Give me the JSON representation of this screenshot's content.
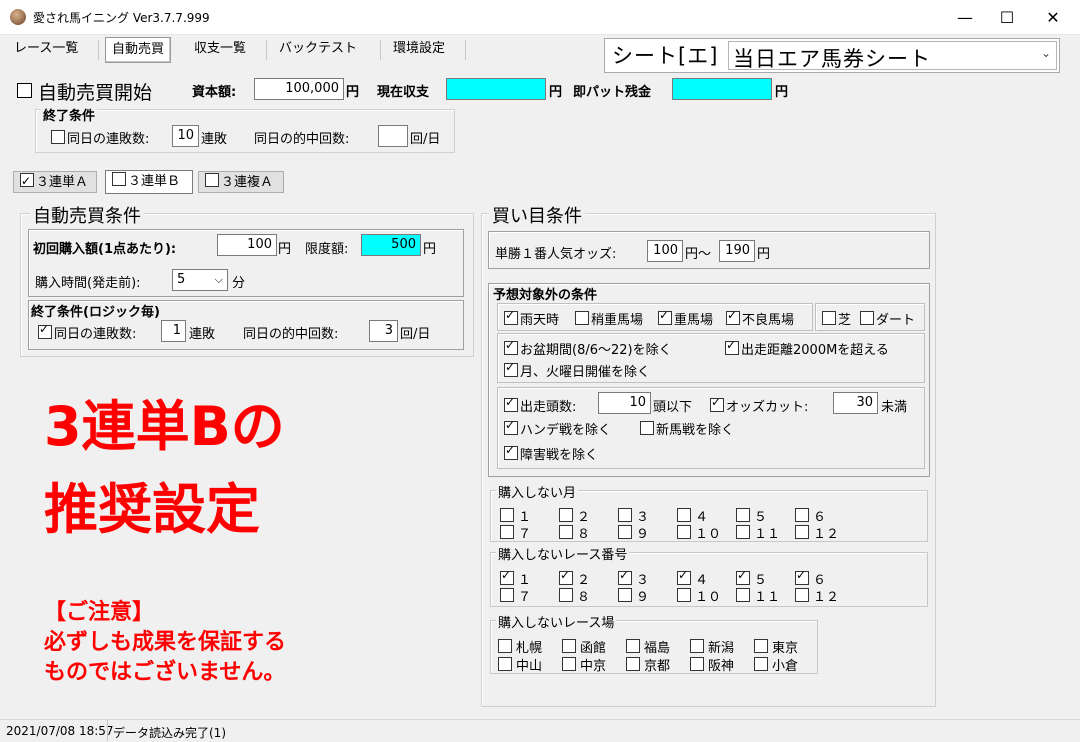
{
  "window": {
    "title": "愛され馬イニング Ver3.7.7.999",
    "minimize": "—",
    "maximize": "☐",
    "close": "✕"
  },
  "tabs": [
    "レース一覧",
    "自動売買",
    "収支一覧",
    "バックテスト",
    "環境設定"
  ],
  "sheet": {
    "label": "シート[エ]",
    "value": "当日エア馬券シート"
  },
  "auto": {
    "start_label": "自動売買開始",
    "capital_label": "資本額:",
    "capital_value": "100,000",
    "yen": "円",
    "profit_label": "現在収支",
    "bat_label": "即パット残金",
    "end_title": "終了条件",
    "end_streak_label": "同日の連敗数:",
    "end_streak_value": "10",
    "end_streak_unit": "連敗",
    "end_hits_label": "同日の的中回数:",
    "end_hits_value": "",
    "end_hits_unit": "回/日"
  },
  "bet_tabs": [
    {
      "label": "３連単Ａ",
      "checked": true
    },
    {
      "label": "３連単Ｂ",
      "checked": false
    },
    {
      "label": "３連複Ａ",
      "checked": false
    }
  ],
  "conditions": {
    "title": "自動売買条件",
    "first_amount_label": "初回購入額(1点あたり):",
    "first_amount_value": "100",
    "yen": "円",
    "limit_label": "限度額:",
    "limit_value": "500",
    "time_label": "購入時間(発走前):",
    "time_value": "5",
    "time_unit": "分",
    "end_title": "終了条件(ロジック毎)",
    "streak_label": "同日の連敗数:",
    "streak_value": "1",
    "streak_unit": "連敗",
    "hits_label": "同日の的中回数:",
    "hits_value": "3",
    "hits_unit": "回/日"
  },
  "overlay": {
    "line1": "3連単Bの",
    "line2": "推奨設定",
    "note1": "【ご注意】",
    "note2": "必ずしも成果を保証する",
    "note3": "ものではございません。"
  },
  "buy": {
    "title": "買い目条件",
    "odds_label": "単勝１番人気オッズ:",
    "odds_min": "100",
    "odds_sep": "円〜",
    "odds_max": "190",
    "yen": "円",
    "exclude_title": "予想対象外の条件",
    "weather": [
      {
        "label": "雨天時",
        "checked": true
      },
      {
        "label": "稍重馬場",
        "checked": false
      },
      {
        "label": "重馬場",
        "checked": true
      },
      {
        "label": "不良馬場",
        "checked": true
      }
    ],
    "surface": [
      {
        "label": "芝",
        "checked": false
      },
      {
        "label": "ダート",
        "checked": false
      }
    ],
    "obon": {
      "label": "お盆期間(8/6〜22)を除く",
      "checked": true
    },
    "distance": {
      "label": "出走距離2000Mを超える",
      "checked": true
    },
    "weekday": {
      "label": "月、火曜日開催を除く",
      "checked": true
    },
    "runners_label": "出走頭数:",
    "runners_value": "10",
    "runners_unit": "頭以下",
    "odds_cut_label": "オッズカット:",
    "odds_cut_value": "30",
    "odds_cut_unit": "未満",
    "handicap": {
      "label": "ハンデ戦を除く",
      "checked": true
    },
    "newcomer": {
      "label": "新馬戦を除く",
      "checked": false
    },
    "obstacle": {
      "label": "障害戦を除く",
      "checked": true
    },
    "months_title": "購入しない月",
    "months": [
      {
        "label": "１",
        "checked": false
      },
      {
        "label": "２",
        "checked": false
      },
      {
        "label": "３",
        "checked": false
      },
      {
        "label": "４",
        "checked": false
      },
      {
        "label": "５",
        "checked": false
      },
      {
        "label": "６",
        "checked": false
      },
      {
        "label": "７",
        "checked": false
      },
      {
        "label": "８",
        "checked": false
      },
      {
        "label": "９",
        "checked": false
      },
      {
        "label": "１０",
        "checked": false
      },
      {
        "label": "１１",
        "checked": false
      },
      {
        "label": "１２",
        "checked": false
      }
    ],
    "races_title": "購入しないレース番号",
    "races": [
      {
        "label": "１",
        "checked": true
      },
      {
        "label": "２",
        "checked": true
      },
      {
        "label": "３",
        "checked": true
      },
      {
        "label": "４",
        "checked": true
      },
      {
        "label": "５",
        "checked": true
      },
      {
        "label": "６",
        "checked": true
      },
      {
        "label": "７",
        "checked": false
      },
      {
        "label": "８",
        "checked": false
      },
      {
        "label": "９",
        "checked": false
      },
      {
        "label": "１０",
        "checked": false
      },
      {
        "label": "１１",
        "checked": false
      },
      {
        "label": "１２",
        "checked": false
      }
    ],
    "venues_title": "購入しないレース場",
    "venues": [
      {
        "label": "札幌",
        "checked": false
      },
      {
        "label": "函館",
        "checked": false
      },
      {
        "label": "福島",
        "checked": false
      },
      {
        "label": "新潟",
        "checked": false
      },
      {
        "label": "東京",
        "checked": false
      },
      {
        "label": "中山",
        "checked": false
      },
      {
        "label": "中京",
        "checked": false
      },
      {
        "label": "京都",
        "checked": false
      },
      {
        "label": "阪神",
        "checked": false
      },
      {
        "label": "小倉",
        "checked": false
      }
    ]
  },
  "status": {
    "datetime": "2021/07/08 18:57",
    "message": "データ読込み完了(1)"
  }
}
